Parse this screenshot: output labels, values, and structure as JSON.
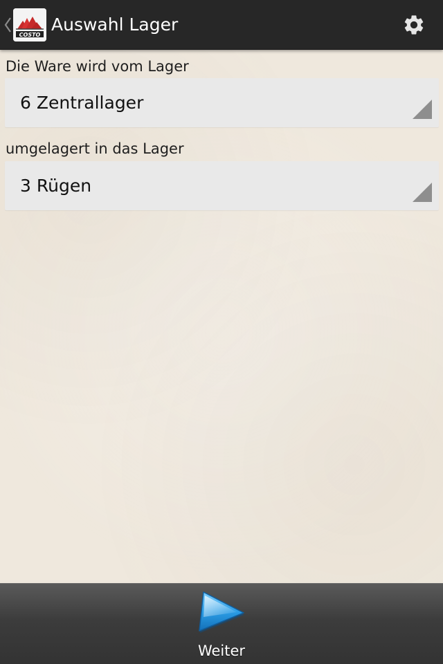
{
  "app": {
    "title": "Auswahl Lager",
    "logo_icon": "costo-logo-icon",
    "settings_icon": "gear-icon",
    "up_icon": "chevron-left-icon"
  },
  "source": {
    "label": "Die Ware wird vom Lager",
    "selected": "6 Zentrallager"
  },
  "target": {
    "label": "umgelagert in das Lager",
    "selected": "3 Rügen"
  },
  "footer": {
    "next_label": "Weiter",
    "next_icon": "play-arrow-icon"
  },
  "colors": {
    "action_bar": "#272727",
    "background": "#efe8dd",
    "spinner": "#e9e9e9",
    "next_icon": "#2b9de6"
  }
}
